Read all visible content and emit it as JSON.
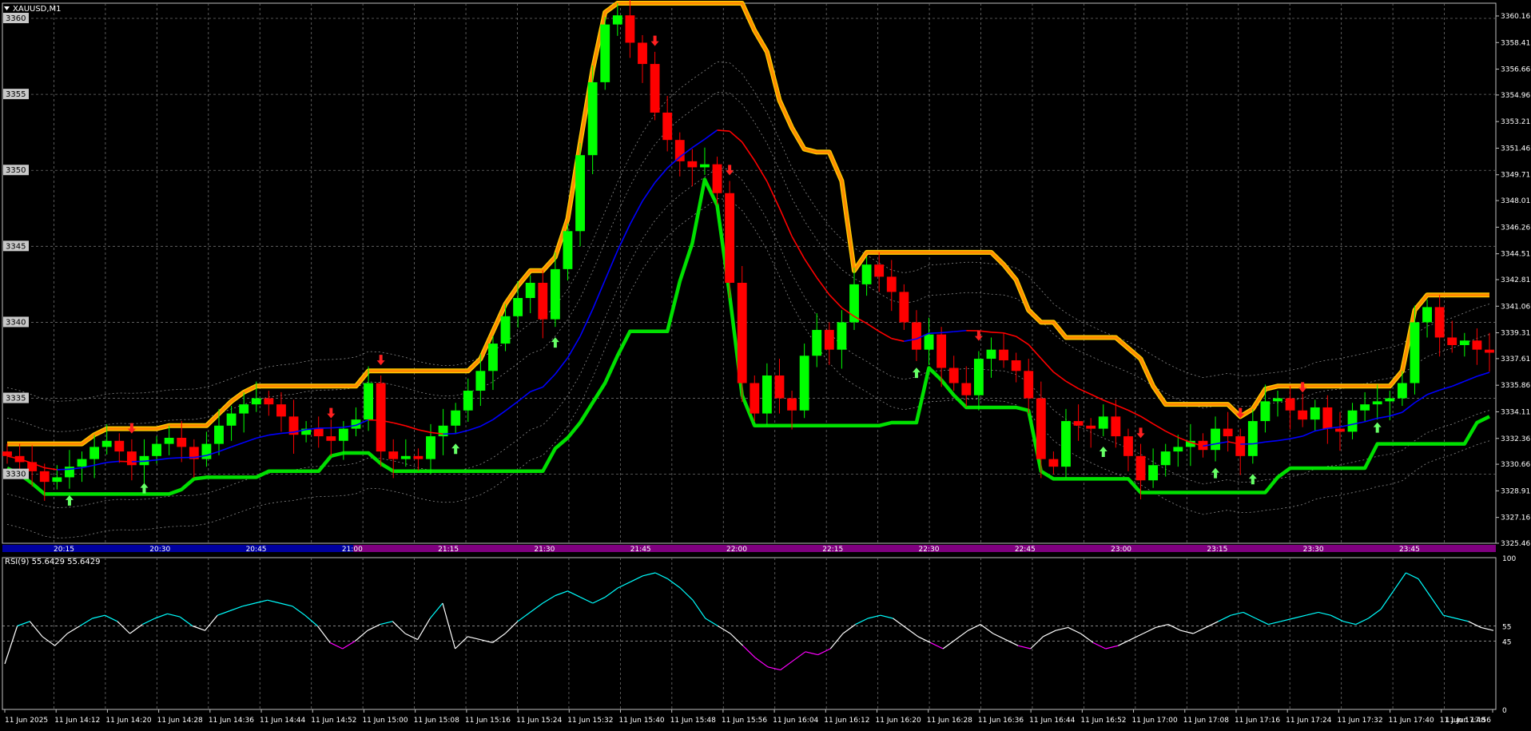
{
  "window": {
    "symbol_title": "XAUUSD,M1",
    "indicator_label": "RSI(9) 55.6429 55.6429"
  },
  "colors": {
    "background": "#000000",
    "grid": "#6e6e6e",
    "bull_candle": "#00ff00",
    "bear_candle": "#ff0000",
    "ma_blue": "#0000ff",
    "ma_red": "#ff0000",
    "upper_band": "#ff8c00",
    "lower_band": "#00e000",
    "rsi_line": "#ffffff",
    "rsi_high": "#00ffff",
    "rsi_low": "#ff00ff",
    "session_bar_a": "#0000a0",
    "session_bar_b": "#800080"
  },
  "chart_data": [
    {
      "type": "candlestick",
      "symbol": "XAUUSD",
      "timeframe": "M1",
      "ylim": [
        3325.46,
        3361.0
      ],
      "price_scale_ticks": [
        "3360.16",
        "3358.41",
        "3356.66",
        "3354.96",
        "3353.21",
        "3351.46",
        "3349.71",
        "3348.01",
        "3346.26",
        "3344.51",
        "3342.81",
        "3341.06",
        "3339.31",
        "3337.61",
        "3335.86",
        "3334.11",
        "3332.36",
        "3330.66",
        "3328.91",
        "3327.16",
        "3325.46"
      ],
      "left_level_labels": [
        "3360",
        "3355",
        "3350",
        "3345",
        "3340",
        "3335",
        "3330"
      ],
      "time_labels_top": [
        "20:15",
        "20:30",
        "20:45",
        "21:00",
        "21:15",
        "21:30",
        "21:45",
        "22:00",
        "22:15",
        "22:30",
        "22:45",
        "23:00",
        "23:15",
        "23:30",
        "23:45"
      ],
      "close_series_approx": [
        3331.2,
        3330.8,
        3330.2,
        3329.5,
        3329.8,
        3330.5,
        3331.0,
        3331.8,
        3332.2,
        3331.5,
        3330.6,
        3331.2,
        3332.0,
        3332.4,
        3331.8,
        3331.0,
        3332.0,
        3333.2,
        3334.0,
        3334.6,
        3335.0,
        3334.6,
        3333.8,
        3332.6,
        3333.0,
        3332.5,
        3332.2,
        3333.0,
        3333.6,
        3336.0,
        3331.5,
        3331.0,
        3331.2,
        3331.0,
        3332.5,
        3333.2,
        3334.2,
        3335.5,
        3336.8,
        3338.6,
        3340.4,
        3341.6,
        3342.6,
        3340.2,
        3343.5,
        3346.0,
        3351.0,
        3355.8,
        3359.6,
        3360.2,
        3358.4,
        3357.0,
        3353.8,
        3352.0,
        3350.6,
        3350.2,
        3350.4,
        3348.5,
        3342.6,
        3336.0,
        3334.0,
        3336.5,
        3335.0,
        3334.2,
        3337.8,
        3339.5,
        3338.2,
        3340.0,
        3342.5,
        3343.8,
        3343.0,
        3342.0,
        3340.0,
        3338.2,
        3339.2,
        3337.0,
        3336.0,
        3335.2,
        3337.6,
        3338.2,
        3337.5,
        3336.8,
        3335.0,
        3331.0,
        3330.5,
        3333.5,
        3333.2,
        3333.0,
        3333.8,
        3332.5,
        3331.2,
        3329.6,
        3330.6,
        3331.5,
        3331.8,
        3332.2,
        3331.6,
        3333.0,
        3332.5,
        3331.2,
        3333.5,
        3334.8,
        3335.0,
        3334.2,
        3333.6,
        3334.4,
        3333.0,
        3332.8,
        3334.2,
        3334.6,
        3334.8,
        3335.0,
        3336.0,
        3340.0,
        3341.0,
        3339.0,
        3338.5,
        3338.8,
        3338.2,
        3338.0
      ]
    },
    {
      "type": "line",
      "indicator": "RSI",
      "period": 9,
      "current_values": [
        "55.6429",
        "55.6429"
      ],
      "ylim": [
        0,
        100
      ],
      "level_labels": [
        "100",
        "55",
        "45",
        "0"
      ],
      "date_labels": [
        "11 Jun 2025",
        "11 Jun 14:12",
        "11 Jun 14:20",
        "11 Jun 14:28",
        "11 Jun 14:36",
        "11 Jun 14:44",
        "11 Jun 14:52",
        "11 Jun 15:00",
        "11 Jun 15:08",
        "11 Jun 15:16",
        "11 Jun 15:24",
        "11 Jun 15:32",
        "11 Jun 15:40",
        "11 Jun 15:48",
        "11 Jun 15:56",
        "11 Jun 16:04",
        "11 Jun 16:12",
        "11 Jun 16:20",
        "11 Jun 16:28",
        "11 Jun 16:36",
        "11 Jun 16:44",
        "11 Jun 16:52",
        "11 Jun 17:00",
        "11 Jun 17:08",
        "11 Jun 17:16",
        "11 Jun 17:24",
        "11 Jun 17:32",
        "11 Jun 17:40",
        "11 Jun 17:48",
        "11 Jun 17:56"
      ],
      "values_approx": [
        30,
        55,
        58,
        48,
        42,
        50,
        55,
        60,
        62,
        58,
        50,
        56,
        60,
        63,
        61,
        55,
        52,
        62,
        65,
        68,
        70,
        72,
        70,
        68,
        62,
        55,
        44,
        40,
        45,
        52,
        56,
        58,
        50,
        46,
        60,
        70,
        40,
        48,
        46,
        44,
        50,
        58,
        64,
        70,
        75,
        78,
        74,
        70,
        74,
        80,
        84,
        88,
        90,
        86,
        80,
        72,
        60,
        55,
        50,
        42,
        34,
        28,
        26,
        32,
        38,
        36,
        40,
        50,
        56,
        60,
        62,
        60,
        54,
        48,
        44,
        40,
        46,
        52,
        56,
        50,
        46,
        42,
        40,
        48,
        52,
        54,
        50,
        44,
        40,
        42,
        46,
        50,
        54,
        56,
        52,
        50,
        54,
        58,
        62,
        64,
        60,
        56,
        58,
        60,
        62,
        64,
        62,
        58,
        56,
        60,
        66,
        78,
        90,
        86,
        74,
        62,
        60,
        58,
        54,
        52
      ]
    }
  ]
}
